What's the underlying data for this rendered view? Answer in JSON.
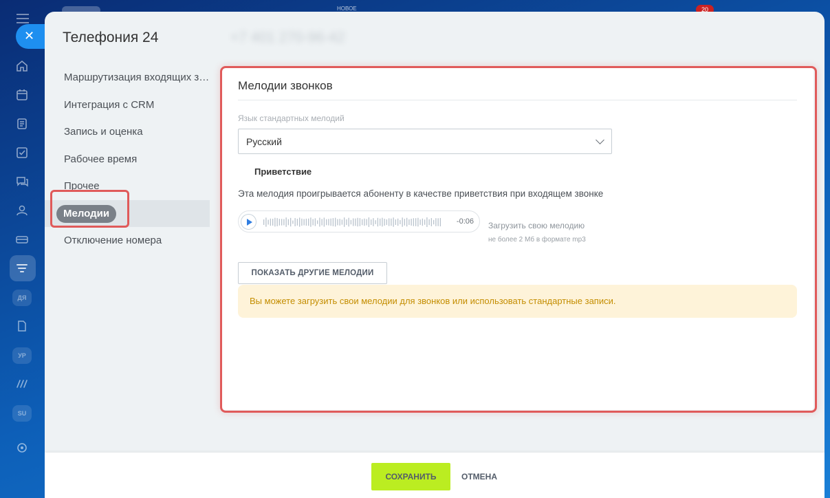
{
  "topbar": {
    "new_label": "НОВОЕ",
    "badge_count": "20"
  },
  "app_sidebar": {
    "pills": [
      "ДЯ",
      "УР",
      "SU"
    ]
  },
  "slider": {
    "title": "Телефония 24",
    "phone_blurred": "+7 401 270-96-42"
  },
  "settings_menu": {
    "items": [
      {
        "label": "Маршрутизация входящих звонков"
      },
      {
        "label": "Интеграция с CRM"
      },
      {
        "label": "Запись и оценка"
      },
      {
        "label": "Рабочее время"
      },
      {
        "label": "Прочее"
      },
      {
        "label": "Мелодии"
      },
      {
        "label": "Отключение номера"
      }
    ],
    "active_index": 5
  },
  "card": {
    "title": "Мелодии звонков",
    "language_label": "Язык стандартных мелодий",
    "language_value": "Русский",
    "greeting_title": "Приветствие",
    "greeting_desc": "Эта мелодия проигрывается абоненту в качестве приветствия при входящем звонке",
    "player_time": "-0:06",
    "upload_link": "Загрузить свою мелодию",
    "upload_hint": "не более 2 Мб в формате mp3",
    "show_more_button": "ПОКАЗАТЬ ДРУГИЕ МЕЛОДИИ",
    "info_text": "Вы можете загрузить свои мелодии для звонков или использовать стандартные записи."
  },
  "footer": {
    "save_button": "СОХРАНИТЬ",
    "cancel_button": "ОТМЕНА"
  },
  "colors": {
    "accent_save": "#bbed21",
    "highlight": "#e05a5a",
    "info_bg": "#fef3d9",
    "info_text": "#c48d00"
  }
}
